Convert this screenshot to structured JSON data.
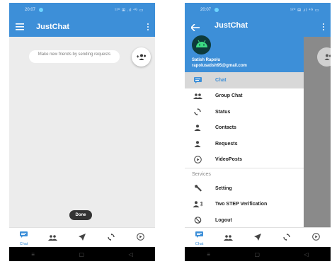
{
  "colors": {
    "primary": "#3d8fd8",
    "content_bg": "#ececec",
    "toast_bg": "#333333",
    "scrim": "#8a8a8a"
  },
  "status_bar": {
    "time": "20:07",
    "icons_text": "¹²⁰ ⊞ .ıl ⁴ᴳ ▭"
  },
  "app": {
    "title": "JustChat"
  },
  "home": {
    "hint": "Make new friends by sending requests",
    "toast": "Done",
    "fab_icon": "add-friend-icon"
  },
  "bottom_nav": {
    "items": [
      {
        "icon": "chat-icon",
        "label": "Chat"
      },
      {
        "icon": "group-icon",
        "label": ""
      },
      {
        "icon": "send-icon",
        "label": ""
      },
      {
        "icon": "refresh-icon",
        "label": ""
      },
      {
        "icon": "play-icon",
        "label": ""
      }
    ]
  },
  "drawer": {
    "user_name": "Satish Rapolu",
    "user_email": "rapolusatish95@gmail.com",
    "items": [
      {
        "icon": "chat-icon",
        "label": "Chat",
        "active": true
      },
      {
        "icon": "group-icon",
        "label": "Group Chat"
      },
      {
        "icon": "refresh-icon",
        "label": "Status"
      },
      {
        "icon": "person-icon",
        "label": "Contacts"
      },
      {
        "icon": "person-icon",
        "label": "Requests"
      },
      {
        "icon": "play-icon",
        "label": "VideoPosts"
      }
    ],
    "section_label": "Services",
    "service_items": [
      {
        "icon": "wrench-icon",
        "label": "Setting"
      },
      {
        "icon": "two-step-icon",
        "label": "Two STEP Verification"
      },
      {
        "icon": "logout-icon",
        "label": "Logout"
      }
    ]
  }
}
